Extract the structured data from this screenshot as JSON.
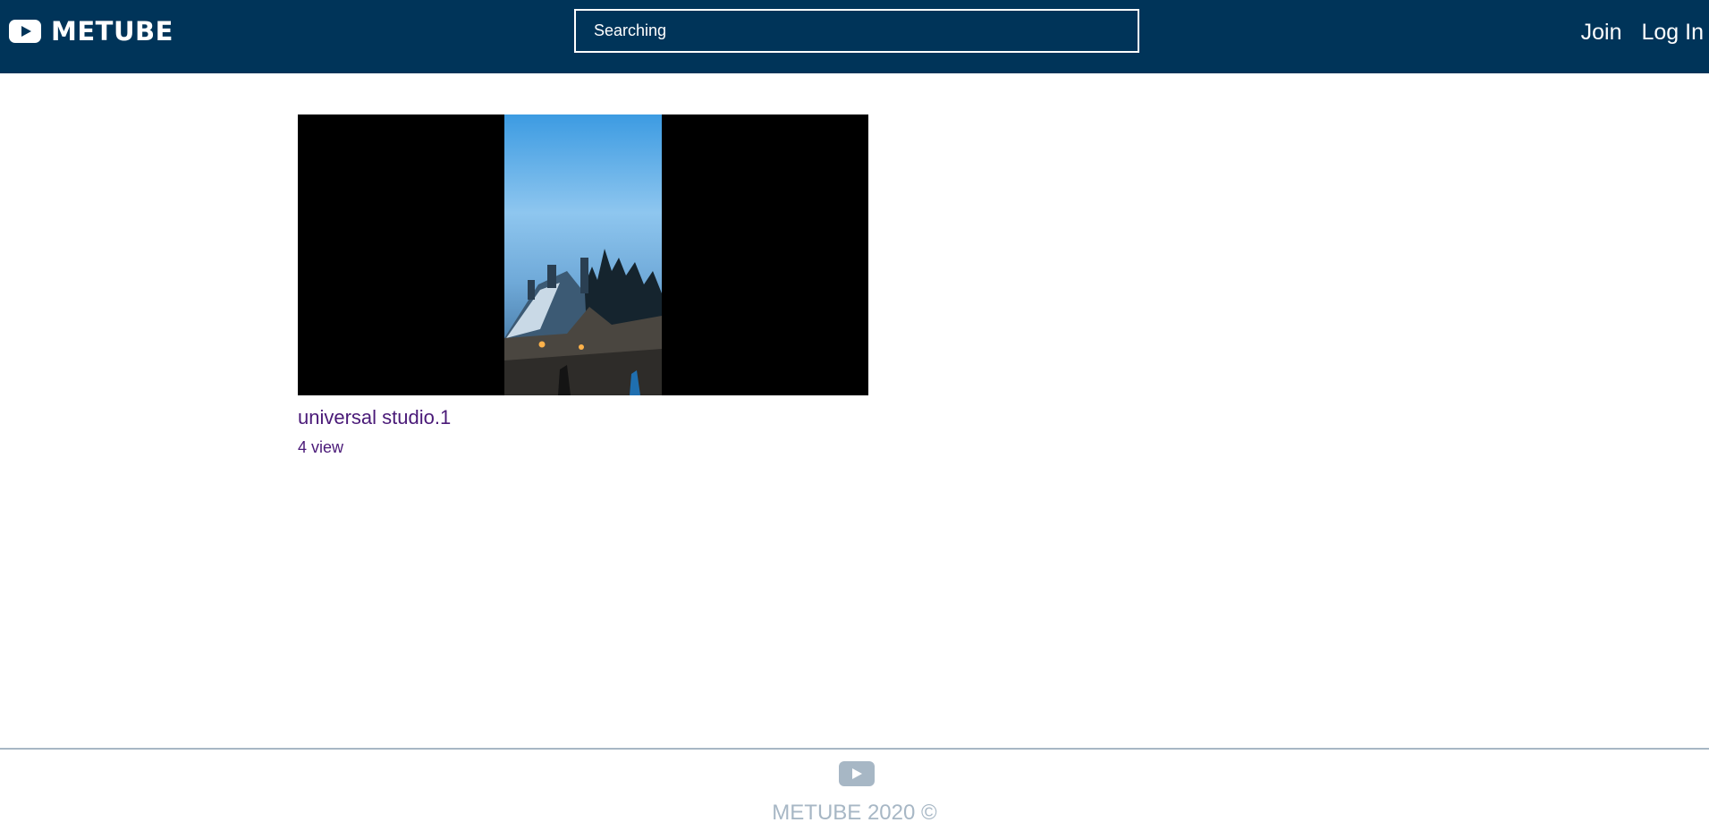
{
  "header": {
    "brand": "METUBE",
    "logo_icon": "youtube-play-icon",
    "search_placeholder": "Searching",
    "nav": {
      "join": "Join",
      "login": "Log In"
    }
  },
  "videos": [
    {
      "title": "universal studio.1",
      "views": "4 view"
    }
  ],
  "footer": {
    "icon": "youtube-play-icon",
    "copyright": "METUBE 2020 ©"
  },
  "colors": {
    "header_bg": "#003459",
    "link": "#4a1a78",
    "footer": "#a7b7c5"
  }
}
